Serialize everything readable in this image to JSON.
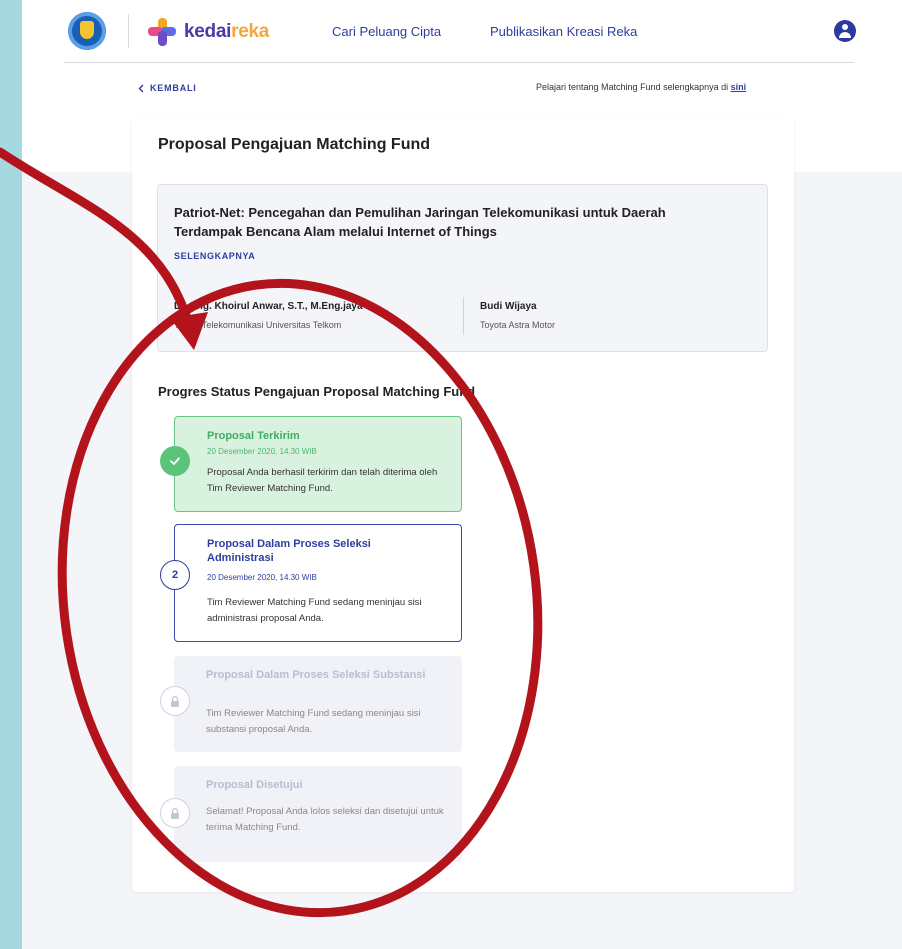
{
  "header": {
    "brand_part1": "kedai",
    "brand_part2": "reka",
    "nav": [
      "Cari Peluang Cipta",
      "Publikasikan Kreasi Reka"
    ]
  },
  "subbar": {
    "back_label": "KEMBALI",
    "learn_text": "Pelajari tentang Matching Fund selengkapnya di",
    "learn_link": "sini"
  },
  "main": {
    "title": "Proposal Pengajuan Matching Fund",
    "project": {
      "title": "Patriot-Net: Pencegahan dan Pemulihan Jaringan Telekomunikasi untuk Daerah Terdampak Bencana Alam melalui Internet of Things",
      "more_label": "SELENGKAPNYA",
      "people": [
        {
          "name": "Dr. Eng. Khoirul Anwar, S.T., M.Eng.jaya",
          "org": "Teknik Telekomunikasi Universitas Telkom"
        },
        {
          "name": "Budi Wijaya",
          "org": "Toyota Astra Motor"
        }
      ]
    },
    "progress_title": "Progres Status Pengajuan Proposal Matching Fund",
    "steps": [
      {
        "marker": "",
        "title": "Proposal Terkirim",
        "date": "20 Desember 2020, 14.30 WIB",
        "desc": "Proposal Anda berhasil terkirim dan telah diterima oleh Tim Reviewer Matching Fund."
      },
      {
        "marker": "2",
        "title": "Proposal Dalam Proses Seleksi Administrasi",
        "date": "20 Desember 2020, 14.30 WIB",
        "desc": "Tim Reviewer Matching Fund sedang meninjau sisi administrasi proposal Anda."
      },
      {
        "marker": "",
        "title": "Proposal Dalam Proses Seleksi Substansi",
        "date": "",
        "desc": "Tim Reviewer Matching Fund sedang meninjau sisi substansi proposal Anda."
      },
      {
        "marker": "",
        "title": "Proposal Disetujui",
        "date": "",
        "desc": "Selamat! Proposal Anda lolos seleksi dan disetujui untuk terima Matching Fund."
      }
    ]
  },
  "colors": {
    "primary": "#2f3e9e",
    "success": "#5cc47a",
    "annotation": "#b3131b",
    "frame": "#a6d8e0"
  }
}
